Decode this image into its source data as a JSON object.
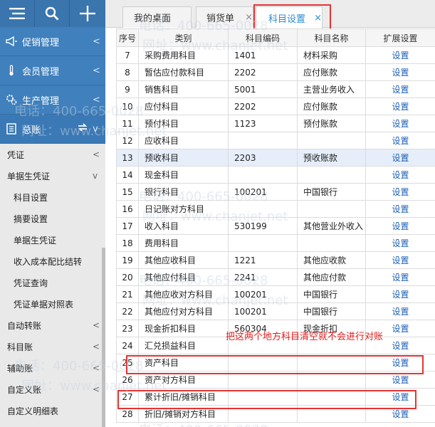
{
  "sidebar": {
    "top_buttons": [
      {
        "icon": "menu-icon"
      },
      {
        "icon": "search-icon"
      },
      {
        "icon": "plus-icon"
      }
    ],
    "blue_menu": [
      {
        "label": "促销管理",
        "icon": "megaphone-icon",
        "chevron": "<"
      },
      {
        "label": "会员管理",
        "icon": "thermometer-icon",
        "chevron": "<"
      },
      {
        "label": "生产管理",
        "icon": "gears-icon",
        "chevron": "<"
      },
      {
        "label": "总账",
        "icon": "ledger-icon",
        "chevron": "v"
      }
    ],
    "sub_menu": [
      {
        "label": "凭证",
        "chevron": "<",
        "level": 1
      },
      {
        "label": "单据生凭证",
        "chevron": "v",
        "level": 1
      },
      {
        "label": "科目设置",
        "chevron": "",
        "level": 2
      },
      {
        "label": "摘要设置",
        "chevron": "",
        "level": 2
      },
      {
        "label": "单据生凭证",
        "chevron": "",
        "level": 2
      },
      {
        "label": "收入成本配比结转",
        "chevron": "",
        "level": 2
      },
      {
        "label": "凭证查询",
        "chevron": "",
        "level": 2
      },
      {
        "label": "凭证单据对照表",
        "chevron": "",
        "level": 2
      },
      {
        "label": "自动转账",
        "chevron": "<",
        "level": 1
      },
      {
        "label": "科目账",
        "chevron": "<",
        "level": 1
      },
      {
        "label": "辅助账",
        "chevron": "<",
        "level": 1
      },
      {
        "label": "自定义账",
        "chevron": "<",
        "level": 1
      },
      {
        "label": "自定义明细表",
        "chevron": "",
        "level": 1
      }
    ]
  },
  "tabs": [
    {
      "label": "我的桌面",
      "closable": false
    },
    {
      "label": "销货单",
      "closable": true
    },
    {
      "label": "科目设置",
      "closable": true,
      "active": true
    }
  ],
  "tab_close_glyph": "×",
  "table": {
    "headers": [
      "序号",
      "类别",
      "科目编码",
      "科目名称",
      "扩展设置"
    ],
    "action_label": "设置",
    "rows": [
      {
        "no": "7",
        "category": "采购费用科目",
        "code": "1401",
        "name": "材料采购"
      },
      {
        "no": "8",
        "category": "暂估应付款科目",
        "code": "2202",
        "name": "应付账款"
      },
      {
        "no": "9",
        "category": "销售科目",
        "code": "5001",
        "name": "主营业务收入"
      },
      {
        "no": "10",
        "category": "应付科目",
        "code": "2202",
        "name": "应付账款"
      },
      {
        "no": "11",
        "category": "预付科目",
        "code": "1123",
        "name": "预付账款"
      },
      {
        "no": "12",
        "category": "应收科目",
        "code": "",
        "name": ""
      },
      {
        "no": "13",
        "category": "预收科目",
        "code": "2203",
        "name": "预收账款",
        "highlight": true
      },
      {
        "no": "14",
        "category": "现金科目",
        "code": "",
        "name": ""
      },
      {
        "no": "15",
        "category": "银行科目",
        "code": "100201",
        "name": "中国银行"
      },
      {
        "no": "16",
        "category": "日记账对方科目",
        "code": "",
        "name": ""
      },
      {
        "no": "17",
        "category": "收入科目",
        "code": "530199",
        "name": "其他营业外收入"
      },
      {
        "no": "18",
        "category": "费用科目",
        "code": "",
        "name": ""
      },
      {
        "no": "19",
        "category": "其他应收科目",
        "code": "1221",
        "name": "其他应收款"
      },
      {
        "no": "20",
        "category": "其他应付科目",
        "code": "2241",
        "name": "其他应付款"
      },
      {
        "no": "21",
        "category": "其他应收对方科目",
        "code": "100201",
        "name": "中国银行"
      },
      {
        "no": "22",
        "category": "其他应付对方科目",
        "code": "100201",
        "name": "中国银行"
      },
      {
        "no": "23",
        "category": "现金折扣科目",
        "code": "560304",
        "name": "现金折扣"
      },
      {
        "no": "24",
        "category": "汇兑损益科目",
        "code": "",
        "name": ""
      },
      {
        "no": "25",
        "category": "资产科目",
        "code": "",
        "name": ""
      },
      {
        "no": "26",
        "category": "资产对方科目",
        "code": "",
        "name": ""
      },
      {
        "no": "27",
        "category": "累计折旧/摊销科目",
        "code": "",
        "name": ""
      },
      {
        "no": "28",
        "category": "折旧/摊销对方科目",
        "code": "",
        "name": ""
      }
    ]
  },
  "annotation": "把这两个地方科目清空就不会进行对账",
  "watermark": {
    "phone": "电话：400-665-0028",
    "site": "网址：www.chanjet.net"
  },
  "colors": {
    "sidebar_blue": "#3f80bd",
    "annotation_red": "#e53333",
    "active_tab": "#2b8ccf",
    "link_blue": "#1c5fb5"
  }
}
